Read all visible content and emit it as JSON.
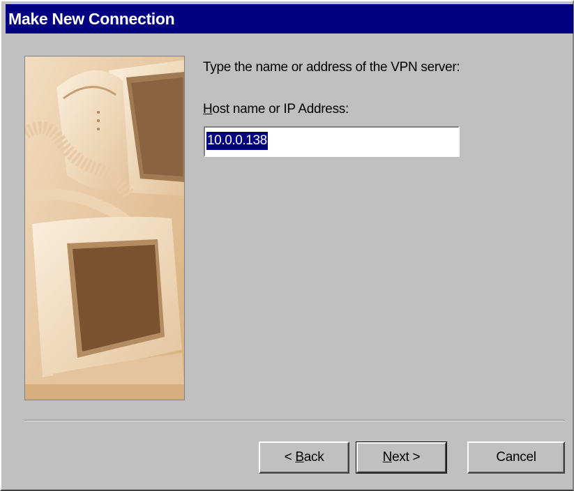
{
  "window": {
    "title": "Make New Connection"
  },
  "wizard": {
    "prompt": "Type the name or address of the VPN server:",
    "field_label_access": "H",
    "field_label_rest": "ost name or IP Address:",
    "host_value": "10.0.0.138"
  },
  "buttons": {
    "back_prefix": "< ",
    "back_access": "B",
    "back_rest": "ack",
    "next_access": "N",
    "next_rest": "ext >",
    "cancel": "Cancel"
  },
  "illustration": {
    "icon": "computer-monitors-and-phone-picture"
  },
  "colors": {
    "title_bar": "#000080",
    "dialog_face": "#c0c0c0",
    "selection": "#000080"
  }
}
